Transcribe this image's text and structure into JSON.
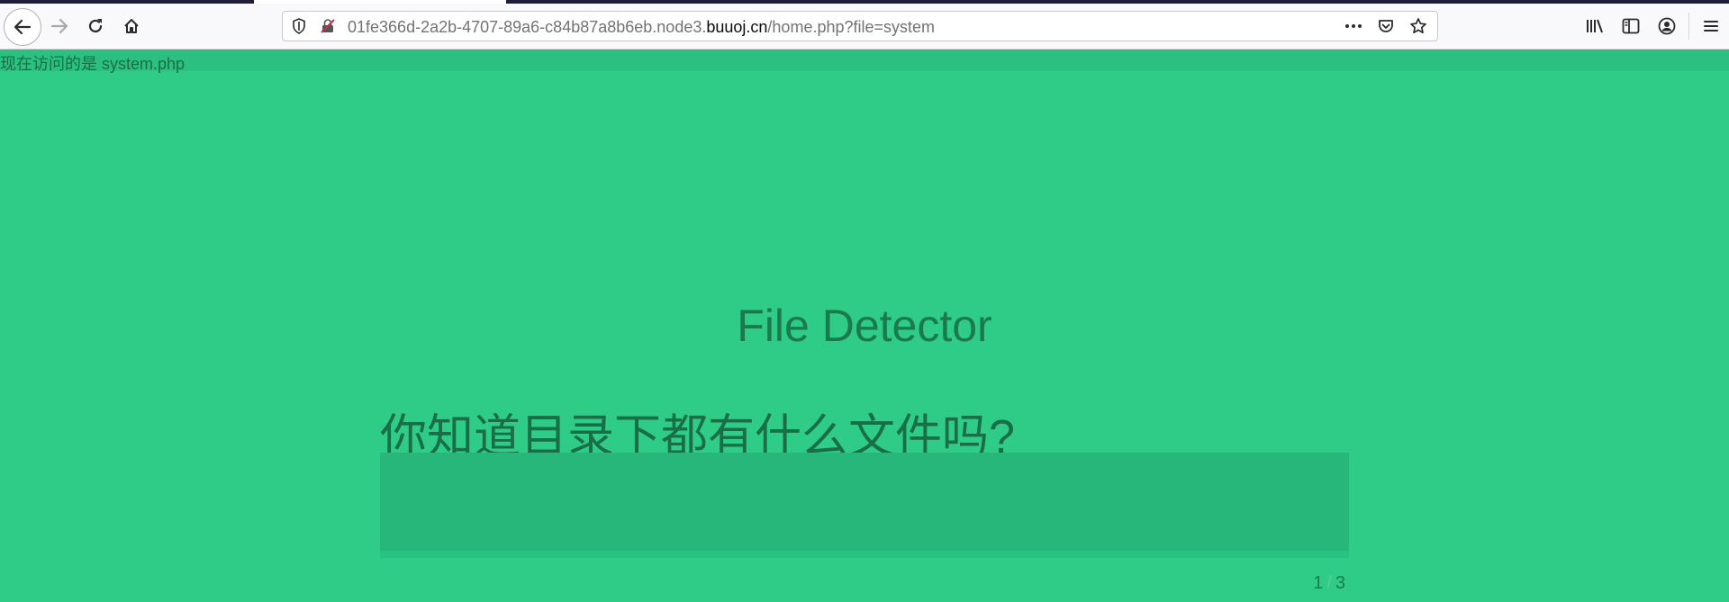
{
  "browser": {
    "url_prefix": "01fe366d-2a2b-4707-89a6-c84b87a8b6eb.node3.",
    "url_domain": "buuoj.cn",
    "url_path": "/home.php?file=system"
  },
  "page": {
    "notice": "现在访问的是 system.php",
    "title": "File Detector",
    "question": "你知道目录下都有什么文件吗?",
    "pager": {
      "current": "1",
      "separator": "/",
      "total": "3"
    }
  },
  "colors": {
    "background": "#2ecc87",
    "text_dark": "#1a6e47",
    "input_bg": "#28b77a"
  }
}
